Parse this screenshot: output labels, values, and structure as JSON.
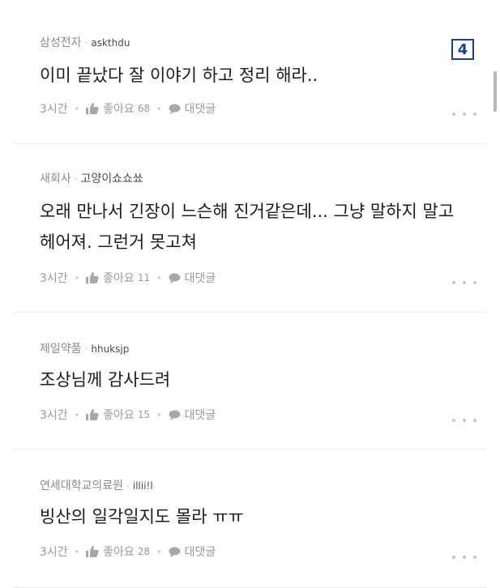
{
  "badge": "4",
  "actions": {
    "like_label": "좋아요",
    "reply_label": "대댓글"
  },
  "comments": [
    {
      "company": "삼성전자",
      "user": "askthdu",
      "text": "이미 끝났다 잘 이야기 하고 정리 해라..",
      "time": "3시간",
      "likes": "68"
    },
    {
      "company": "새회사",
      "user": "고양이쇼쇼쑈",
      "text": "오래 만나서 긴장이 느슨해 진거같은데... 그냥 말하지 말고 헤어져. 그런거 못고쳐",
      "time": "3시간",
      "likes": "11"
    },
    {
      "company": "제일약품",
      "user": "hhuksjp",
      "text": "조상님께 감사드려",
      "time": "3시간",
      "likes": "15"
    },
    {
      "company": "연세대학교의료원",
      "user": "illii!l",
      "text": "빙산의 일각일지도 몰라 ㅠㅠ",
      "time": "3시간",
      "likes": "28"
    }
  ]
}
